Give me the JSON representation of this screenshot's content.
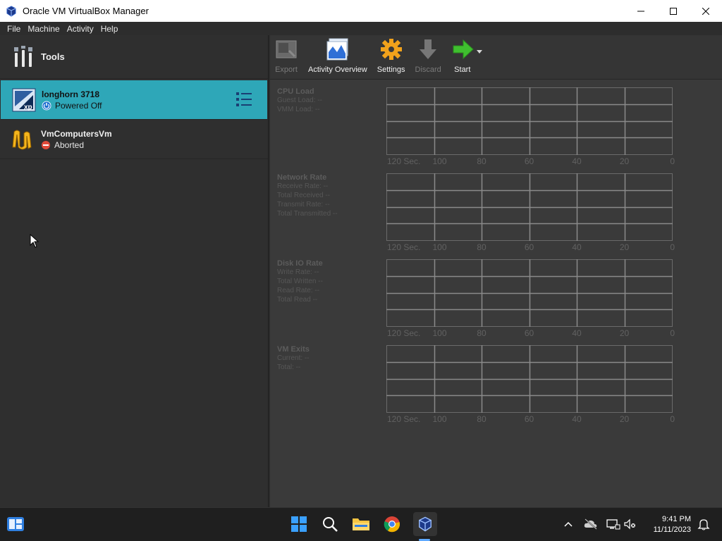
{
  "window": {
    "title": "Oracle VM VirtualBox Manager"
  },
  "menu": {
    "items": [
      "File",
      "Machine",
      "Activity",
      "Help"
    ]
  },
  "sidebar": {
    "tools_label": "Tools",
    "vms": [
      {
        "name": "longhorn 3718",
        "state": "Powered Off",
        "selected": true
      },
      {
        "name": "VmComputersVm",
        "state": "Aborted",
        "selected": false
      }
    ]
  },
  "toolbar": {
    "export_label": "Export",
    "activity_label": "Activity Overview",
    "settings_label": "Settings",
    "discard_label": "Discard",
    "start_label": "Start"
  },
  "metrics": [
    {
      "title": "CPU Load",
      "lines": [
        "Guest Load: --",
        "VMM Load: --"
      ]
    },
    {
      "title": "Network Rate",
      "lines": [
        "Receive Rate: --",
        "Total Received --",
        "Transmit Rate: --",
        "Total Transmitted --"
      ]
    },
    {
      "title": "Disk IO Rate",
      "lines": [
        "Write Rate: --",
        "Total Written --",
        "Read Rate: --",
        "Total Read --"
      ]
    },
    {
      "title": "VM Exits",
      "lines": [
        "Current: --",
        "Total: --"
      ]
    }
  ],
  "axis_ticks": [
    "120 Sec.",
    "100",
    "80",
    "60",
    "40",
    "20",
    "0"
  ],
  "clock": {
    "time": "9:41 PM",
    "date": "11/11/2023"
  },
  "colors": {
    "selection": "#2ea7b8",
    "accent_start": "#3fbf2f",
    "settings_gear": "#f2a21b"
  }
}
